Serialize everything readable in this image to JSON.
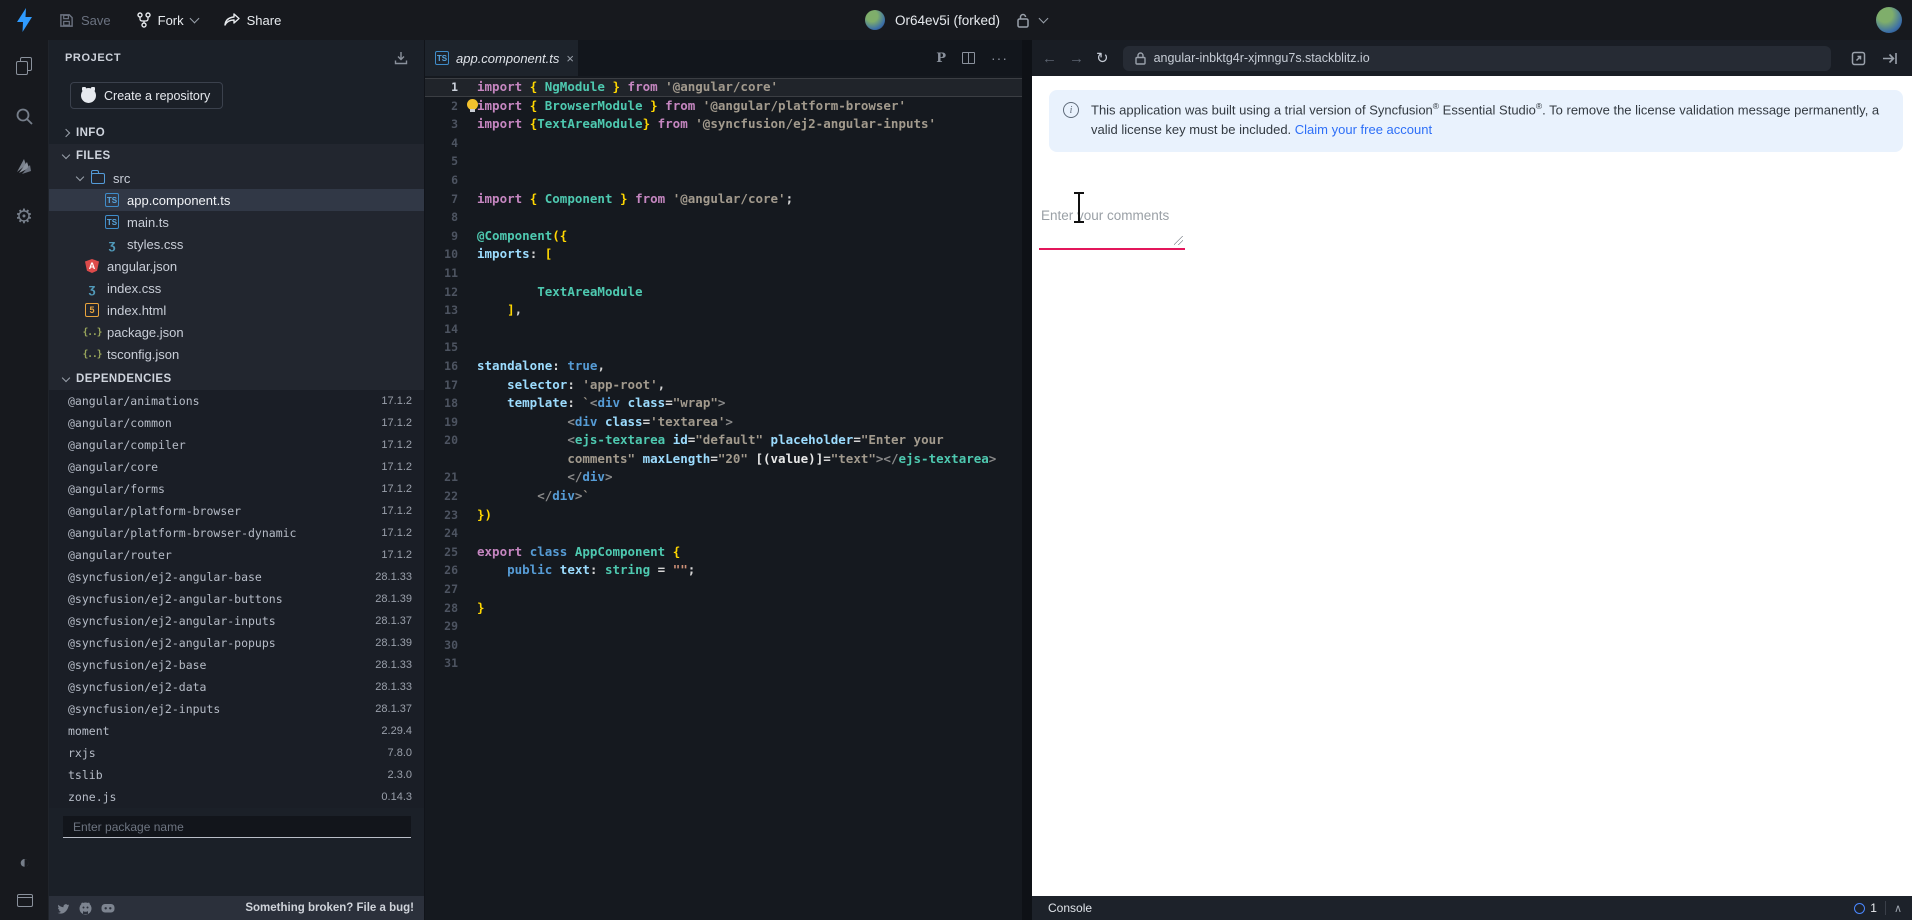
{
  "topbar": {
    "save_label": "Save",
    "fork_label": "Fork",
    "share_label": "Share",
    "title": "Or64ev5i (forked)"
  },
  "sidebar": {
    "header": "PROJECT",
    "create_repo_label": "Create a repository",
    "sections": {
      "info": "INFO",
      "files": "FILES",
      "dependencies": "DEPENDENCIES"
    },
    "files": [
      {
        "label": "src",
        "icon": "folder-icon",
        "kind": "folder",
        "depth": 0,
        "expanded": true
      },
      {
        "label": "app.component.ts",
        "icon": "ts-icon",
        "kind": "ts",
        "depth": 1,
        "selected": true
      },
      {
        "label": "main.ts",
        "icon": "ts-icon",
        "kind": "ts",
        "depth": 1
      },
      {
        "label": "styles.css",
        "icon": "css-icon",
        "kind": "css",
        "depth": 1
      },
      {
        "label": "angular.json",
        "icon": "angular-icon",
        "kind": "angular",
        "depth": 0
      },
      {
        "label": "index.css",
        "icon": "css-icon",
        "kind": "css",
        "depth": 0
      },
      {
        "label": "index.html",
        "icon": "html-icon",
        "kind": "html",
        "depth": 0
      },
      {
        "label": "package.json",
        "icon": "json-icon",
        "kind": "json",
        "depth": 0
      },
      {
        "label": "tsconfig.json",
        "icon": "json-icon",
        "kind": "json",
        "depth": 0
      }
    ],
    "dependencies": [
      {
        "name": "@angular/animations",
        "version": "17.1.2"
      },
      {
        "name": "@angular/common",
        "version": "17.1.2"
      },
      {
        "name": "@angular/compiler",
        "version": "17.1.2"
      },
      {
        "name": "@angular/core",
        "version": "17.1.2"
      },
      {
        "name": "@angular/forms",
        "version": "17.1.2"
      },
      {
        "name": "@angular/platform-browser",
        "version": "17.1.2"
      },
      {
        "name": "@angular/platform-browser-dynamic",
        "version": "17.1.2"
      },
      {
        "name": "@angular/router",
        "version": "17.1.2"
      },
      {
        "name": "@syncfusion/ej2-angular-base",
        "version": "28.1.33"
      },
      {
        "name": "@syncfusion/ej2-angular-buttons",
        "version": "28.1.39"
      },
      {
        "name": "@syncfusion/ej2-angular-inputs",
        "version": "28.1.37"
      },
      {
        "name": "@syncfusion/ej2-angular-popups",
        "version": "28.1.39"
      },
      {
        "name": "@syncfusion/ej2-base",
        "version": "28.1.33"
      },
      {
        "name": "@syncfusion/ej2-data",
        "version": "28.1.33"
      },
      {
        "name": "@syncfusion/ej2-inputs",
        "version": "28.1.37"
      },
      {
        "name": "moment",
        "version": "2.29.4"
      },
      {
        "name": "rxjs",
        "version": "7.8.0"
      },
      {
        "name": "tslib",
        "version": "2.3.0"
      },
      {
        "name": "zone.js",
        "version": "0.14.3"
      }
    ],
    "package_input_placeholder": "Enter package name",
    "bug_link": "Something broken? File a bug!"
  },
  "editor": {
    "tab_label": "app.component.ts",
    "lines": [
      {
        "n": "1",
        "active": true,
        "seg": [
          [
            "k",
            "import "
          ],
          [
            "b",
            "{"
          ],
          [
            "t",
            " NgModule "
          ],
          [
            "b",
            "}"
          ],
          [
            "k",
            " from "
          ],
          [
            "s",
            "'@angular/core'"
          ]
        ]
      },
      {
        "n": "2",
        "seg": [
          [
            "k",
            "import "
          ],
          [
            "b",
            "{"
          ],
          [
            "t",
            " BrowserModule "
          ],
          [
            "b",
            "}"
          ],
          [
            "k",
            " from "
          ],
          [
            "s",
            "'@angular/platform-browser'"
          ]
        ]
      },
      {
        "n": "3",
        "seg": [
          [
            "k",
            "import "
          ],
          [
            "b",
            "{"
          ],
          [
            "t",
            "TextAreaModule"
          ],
          [
            "b",
            "}"
          ],
          [
            "k",
            " from "
          ],
          [
            "s",
            "'@syncfusion/ej2-angular-inputs'"
          ]
        ]
      },
      {
        "n": "4",
        "seg": []
      },
      {
        "n": "5",
        "seg": []
      },
      {
        "n": "6",
        "seg": []
      },
      {
        "n": "7",
        "seg": [
          [
            "k",
            "import "
          ],
          [
            "b",
            "{"
          ],
          [
            "t",
            " Component "
          ],
          [
            "b",
            "}"
          ],
          [
            "k",
            " from "
          ],
          [
            "s",
            "'@angular/core'"
          ],
          [
            "p",
            ";"
          ]
        ]
      },
      {
        "n": "8",
        "seg": []
      },
      {
        "n": "9",
        "seg": [
          [
            "t",
            "@Component"
          ],
          [
            "b",
            "({"
          ]
        ]
      },
      {
        "n": "10",
        "seg": [
          [
            "prop",
            "imports"
          ],
          [
            "p",
            ": "
          ],
          [
            "b",
            "["
          ]
        ]
      },
      {
        "n": "11",
        "seg": []
      },
      {
        "n": "12",
        "seg": [
          [
            "p",
            "        "
          ],
          [
            "t",
            "TextAreaModule"
          ]
        ]
      },
      {
        "n": "13",
        "seg": [
          [
            "p",
            "    "
          ],
          [
            "b",
            "]"
          ],
          [
            "p",
            ","
          ]
        ]
      },
      {
        "n": "14",
        "seg": []
      },
      {
        "n": "15",
        "seg": []
      },
      {
        "n": "16",
        "seg": [
          [
            "prop",
            "standalone"
          ],
          [
            "p",
            ": "
          ],
          [
            "kb",
            "true"
          ],
          [
            "p",
            ","
          ]
        ]
      },
      {
        "n": "17",
        "seg": [
          [
            "p",
            "    "
          ],
          [
            "prop",
            "selector"
          ],
          [
            "p",
            ": "
          ],
          [
            "s",
            "'app-root'"
          ],
          [
            "p",
            ","
          ]
        ]
      },
      {
        "n": "18",
        "seg": [
          [
            "p",
            "    "
          ],
          [
            "prop",
            "template"
          ],
          [
            "p",
            ": "
          ],
          [
            "s",
            "`"
          ],
          [
            "ang",
            "<"
          ],
          [
            "tag",
            "div"
          ],
          [
            "p",
            " "
          ],
          [
            "attr",
            "class"
          ],
          [
            "p",
            "="
          ],
          [
            "s",
            "\"wrap\""
          ],
          [
            "ang",
            ">"
          ]
        ]
      },
      {
        "n": "19",
        "seg": [
          [
            "p",
            "            "
          ],
          [
            "ang",
            "<"
          ],
          [
            "tag",
            "div"
          ],
          [
            "p",
            " "
          ],
          [
            "attr",
            "class"
          ],
          [
            "p",
            "="
          ],
          [
            "s",
            "'textarea'"
          ],
          [
            "ang",
            ">"
          ]
        ]
      },
      {
        "n": "20",
        "seg": [
          [
            "p",
            "            "
          ],
          [
            "ang",
            "<"
          ],
          [
            "t",
            "ejs-textarea"
          ],
          [
            "p",
            " "
          ],
          [
            "attr",
            "id"
          ],
          [
            "p",
            "="
          ],
          [
            "s",
            "\"default\""
          ],
          [
            "p",
            " "
          ],
          [
            "attr",
            "placeholder"
          ],
          [
            "p",
            "="
          ],
          [
            "s",
            "\"Enter your"
          ]
        ]
      },
      {
        "n": "",
        "seg": [
          [
            "p",
            "            "
          ],
          [
            "s",
            "comments\""
          ],
          [
            "p",
            " "
          ],
          [
            "attr",
            "maxLength"
          ],
          [
            "p",
            "="
          ],
          [
            "s",
            "\"20\""
          ],
          [
            "p",
            " "
          ],
          [
            "bn",
            "[(value)]"
          ],
          [
            "p",
            "="
          ],
          [
            "s",
            "\"text\""
          ],
          [
            "ang",
            "></"
          ],
          [
            "t",
            "ejs-textarea"
          ],
          [
            "ang",
            ">"
          ]
        ]
      },
      {
        "n": "21",
        "seg": [
          [
            "p",
            "            "
          ],
          [
            "ang",
            "</"
          ],
          [
            "tag",
            "div"
          ],
          [
            "ang",
            ">"
          ]
        ]
      },
      {
        "n": "22",
        "seg": [
          [
            "p",
            "        "
          ],
          [
            "ang",
            "</"
          ],
          [
            "tag",
            "div"
          ],
          [
            "ang",
            ">"
          ],
          [
            "s",
            "`"
          ]
        ]
      },
      {
        "n": "23",
        "seg": [
          [
            "b",
            "})"
          ]
        ]
      },
      {
        "n": "24",
        "seg": []
      },
      {
        "n": "25",
        "seg": [
          [
            "k",
            "export "
          ],
          [
            "kb",
            "class "
          ],
          [
            "t",
            "AppComponent "
          ],
          [
            "b",
            "{"
          ]
        ]
      },
      {
        "n": "26",
        "seg": [
          [
            "p",
            "    "
          ],
          [
            "kb",
            "public "
          ],
          [
            "prop",
            "text"
          ],
          [
            "p",
            ": "
          ],
          [
            "t",
            "string"
          ],
          [
            "p",
            " = "
          ],
          [
            "os",
            "\"\""
          ],
          [
            "p",
            ";"
          ]
        ]
      },
      {
        "n": "27",
        "seg": []
      },
      {
        "n": "28",
        "seg": [
          [
            "b",
            "}"
          ]
        ]
      },
      {
        "n": "29",
        "seg": []
      },
      {
        "n": "30",
        "seg": []
      },
      {
        "n": "31",
        "seg": []
      }
    ]
  },
  "preview": {
    "url": "angular-inbktg4r-xjmngu7s.stackblitz.io",
    "banner": {
      "p1": "This application was built using a trial version of Syncfusion",
      "sup1": "®",
      "p2": " Essential Studio",
      "sup2": "®",
      "p3": ". To remove the license validation message permanently, a valid license key must be included. ",
      "link": "Claim your free account"
    },
    "textarea_placeholder": "Enter your comments",
    "console": {
      "label": "Console",
      "count": "1"
    }
  }
}
